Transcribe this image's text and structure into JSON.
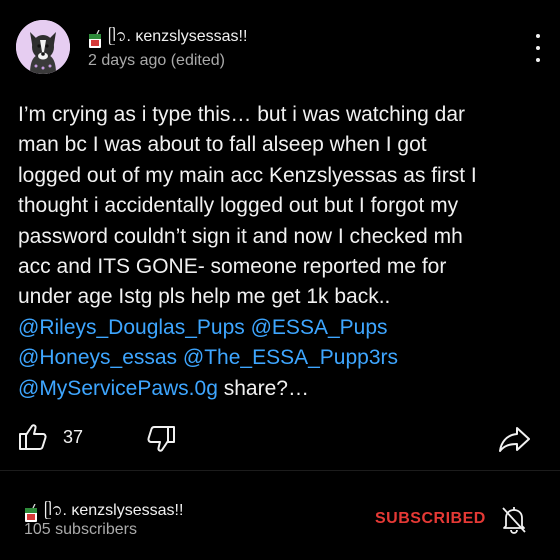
{
  "comment": {
    "author": "ᥫ᭡. ĸenzslysessas!!",
    "meta": "2 days ago (edited)",
    "lines": [
      "I’m crying as i type this… but i was watching dar",
      "man bc I was about to fall alseep when I got",
      "logged out of my main acc Kenzslyessas as first I",
      "thought i accidentally logged out but I forgot my",
      "password couldn’t sign it and now I checked mh",
      "acc and ITS GONE- someone reported me for",
      "under age Istg pls help me get 1k back.."
    ],
    "mentions": {
      "line1": [
        "@Rileys_Douglas_Pups",
        "@ESSA_Pups"
      ],
      "line2": [
        "@Honeys_essas",
        "@The_ESSA_Pupp3rs"
      ],
      "line3": "@MyServicePaws.0g"
    },
    "trailing": "share?…"
  },
  "actions": {
    "like_count": "37",
    "like_icon": "thumb-up-icon",
    "dislike_icon": "thumb-down-icon",
    "share_icon": "share-icon"
  },
  "channel": {
    "name": "ᥫ᭡. ĸenzslysessas!!",
    "subscribers": "105 subscribers",
    "subscribe_label": "SUBSCRIBED",
    "bell_icon": "notifications-off-icon"
  },
  "colors": {
    "background": "#000000",
    "text": "#f1f1f1",
    "secondary": "#aaaaaa",
    "mention": "#3ea6ff",
    "subscribed": "#e53935"
  }
}
